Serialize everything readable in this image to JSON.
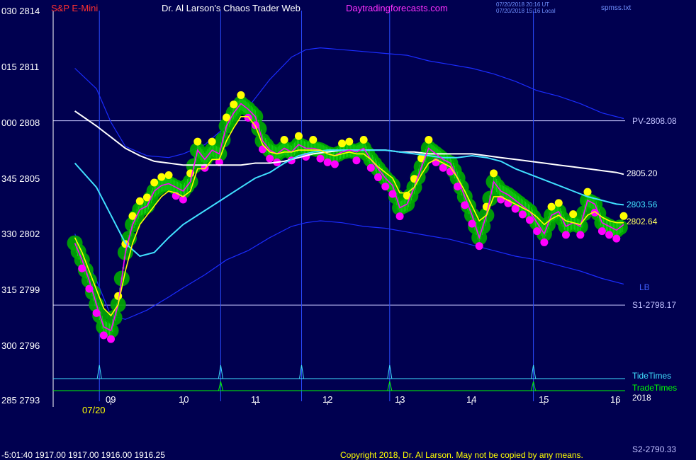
{
  "header": {
    "symbol": "S&P E-Mini",
    "title": "Dr. Al Larson's Chaos Trader Web",
    "site": "Daytradingforecasts.com",
    "stamp1": "07/20/2018 20:16 UT",
    "stamp2": "07/20/2018 15:16 Local",
    "file": "spmss.txt"
  },
  "y_axis": [
    {
      "label": "030  2814"
    },
    {
      "label": "015  2811"
    },
    {
      "label": "000  2808"
    },
    {
      "label": "345  2805"
    },
    {
      "label": "330  2802"
    },
    {
      "label": "315  2799"
    },
    {
      "label": "300  2796"
    },
    {
      "label": "285  2793"
    }
  ],
  "x_axis": {
    "hours": [
      "09",
      "10",
      "11",
      "12",
      "13",
      "14",
      "15",
      "16"
    ],
    "date": "07/20"
  },
  "right_labels": {
    "pv": "PV-2808.08",
    "white_ma": "2805.20",
    "cyan_ma": "2803.56",
    "yellow_ma": "2802.64",
    "lb": "LB",
    "s1": "S1-2798.17",
    "tide": "TideTimes",
    "trade": "TradeTimes",
    "year": "2018",
    "s2": "S2-2790.33"
  },
  "footer": {
    "quote": "-5:01:40  1917.00 1917.00 1916.00 1916.25",
    "copyright": "Copyright 2018, Dr. Al Larson. May not be copied by any means."
  },
  "colors": {
    "background": "#000050",
    "price": "#ff00ff",
    "bubble_green": "#00aa00",
    "yellow": "#ffff00",
    "cyan": "#40e0ff",
    "white": "#ffffff",
    "band": "#1a2cff",
    "tide": "#40e0ff",
    "trade": "#00ff00"
  },
  "chart_data": {
    "type": "line",
    "title": "S&P E-Mini",
    "ylim": [
      2793,
      2814
    ],
    "xlim": [
      8.5,
      16.1
    ],
    "pv_level": 2808.08,
    "s1_level": 2798.17,
    "tide_times": [
      8.84,
      10.52,
      11.64,
      12.86,
      14.85
    ],
    "trade_times": [
      10.52,
      12.86,
      14.85
    ],
    "series": [
      {
        "name": "price",
        "x": [
          8.5,
          8.6,
          8.7,
          8.8,
          8.9,
          9.0,
          9.1,
          9.2,
          9.3,
          9.4,
          9.5,
          9.6,
          9.7,
          9.8,
          9.9,
          10.0,
          10.1,
          10.2,
          10.3,
          10.4,
          10.5,
          10.6,
          10.7,
          10.8,
          10.9,
          11.0,
          11.1,
          11.2,
          11.3,
          11.4,
          11.5,
          11.6,
          11.7,
          11.8,
          11.9,
          12.0,
          12.1,
          12.2,
          12.3,
          12.4,
          12.5,
          12.6,
          12.7,
          12.8,
          12.9,
          13.0,
          13.1,
          13.2,
          13.3,
          13.4,
          13.5,
          13.6,
          13.7,
          13.8,
          13.9,
          14.0,
          14.1,
          14.2,
          14.3,
          14.4,
          14.5,
          14.6,
          14.7,
          14.8,
          14.9,
          15.0,
          15.1,
          15.2,
          15.3,
          15.4,
          15.5,
          15.6,
          15.7,
          15.8,
          15.9,
          16.0,
          16.1
        ],
        "values": [
          2801.5,
          2800.6,
          2799.5,
          2798.2,
          2797.0,
          2796.8,
          2798.2,
          2801.0,
          2802.5,
          2803.3,
          2803.5,
          2804.3,
          2804.6,
          2804.7,
          2804.5,
          2804.3,
          2804.8,
          2806.5,
          2806.0,
          2806.5,
          2806.3,
          2807.8,
          2808.5,
          2809.0,
          2808.7,
          2808.3,
          2807.0,
          2806.5,
          2806.3,
          2806.6,
          2806.4,
          2806.8,
          2806.6,
          2806.6,
          2806.5,
          2806.3,
          2806.2,
          2806.4,
          2806.5,
          2806.4,
          2806.6,
          2806.0,
          2805.5,
          2805.0,
          2804.6,
          2803.4,
          2803.6,
          2804.5,
          2805.6,
          2806.6,
          2806.3,
          2806.0,
          2805.8,
          2805.0,
          2804.0,
          2803.0,
          2801.8,
          2803.0,
          2804.8,
          2804.3,
          2804.1,
          2803.8,
          2803.5,
          2803.2,
          2802.6,
          2802.0,
          2803.0,
          2803.2,
          2802.4,
          2802.6,
          2802.4,
          2803.8,
          2803.6,
          2802.6,
          2802.4,
          2802.2,
          2802.5
        ]
      },
      {
        "name": "yellow",
        "x": [
          8.5,
          8.6,
          8.7,
          8.8,
          8.9,
          9.0,
          9.1,
          9.2,
          9.3,
          9.4,
          9.5,
          9.6,
          9.7,
          9.8,
          9.9,
          10.0,
          10.1,
          10.2,
          10.3,
          10.4,
          10.5,
          10.6,
          10.7,
          10.8,
          10.9,
          11.0,
          11.1,
          11.2,
          11.3,
          11.4,
          11.5,
          11.6,
          11.7,
          11.8,
          11.9,
          12.0,
          12.1,
          12.2,
          12.3,
          12.4,
          12.5,
          12.6,
          12.7,
          12.8,
          12.9,
          13.0,
          13.1,
          13.2,
          13.3,
          13.4,
          13.5,
          13.6,
          13.7,
          13.8,
          13.9,
          14.0,
          14.1,
          14.2,
          14.3,
          14.4,
          14.5,
          14.6,
          14.7,
          14.8,
          14.9,
          15.0,
          15.1,
          15.2,
          15.3,
          15.4,
          15.5,
          15.6,
          15.7,
          15.8,
          15.9,
          16.0,
          16.1
        ],
        "values": [
          2801.8,
          2801.0,
          2800.0,
          2799.0,
          2798.0,
          2797.6,
          2798.2,
          2800.0,
          2801.5,
          2802.5,
          2803.0,
          2803.5,
          2804.0,
          2804.3,
          2804.2,
          2804.0,
          2804.3,
          2805.5,
          2805.5,
          2806.0,
          2806.0,
          2807.0,
          2807.7,
          2808.3,
          2808.3,
          2807.8,
          2806.8,
          2806.4,
          2806.3,
          2806.4,
          2806.4,
          2806.5,
          2806.5,
          2806.5,
          2806.5,
          2806.3,
          2806.2,
          2806.3,
          2806.4,
          2806.3,
          2806.3,
          2806.0,
          2805.6,
          2805.3,
          2805.0,
          2804.2,
          2804.2,
          2804.5,
          2805.2,
          2805.8,
          2806.0,
          2805.8,
          2805.6,
          2805.0,
          2804.3,
          2803.5,
          2802.7,
          2803.0,
          2804.0,
          2804.0,
          2803.8,
          2803.6,
          2803.4,
          2803.2,
          2802.9,
          2802.5,
          2802.8,
          2803.0,
          2802.7,
          2802.6,
          2802.5,
          2803.0,
          2803.2,
          2802.9,
          2802.7,
          2802.6,
          2802.6
        ]
      },
      {
        "name": "cyan",
        "x": [
          8.5,
          8.8,
          9.0,
          9.2,
          9.4,
          9.6,
          9.8,
          10.0,
          10.2,
          10.4,
          10.6,
          10.8,
          11.0,
          11.2,
          11.4,
          11.6,
          11.8,
          12.0,
          12.2,
          12.4,
          12.6,
          12.8,
          13.0,
          13.2,
          13.4,
          13.6,
          13.8,
          14.0,
          14.2,
          14.4,
          14.6,
          14.8,
          15.0,
          15.2,
          15.4,
          15.6,
          15.8,
          16.0,
          16.1
        ],
        "values": [
          2805.8,
          2804.5,
          2803.0,
          2801.5,
          2800.8,
          2801.0,
          2801.8,
          2802.5,
          2803.0,
          2803.5,
          2804.0,
          2804.5,
          2805.0,
          2805.3,
          2805.8,
          2806.2,
          2806.4,
          2806.5,
          2806.5,
          2806.5,
          2806.5,
          2806.5,
          2806.4,
          2806.3,
          2806.2,
          2806.1,
          2806.1,
          2806.2,
          2806.1,
          2805.9,
          2805.5,
          2805.2,
          2804.9,
          2804.6,
          2804.3,
          2804.0,
          2803.8,
          2803.6,
          2803.56
        ]
      },
      {
        "name": "white",
        "x": [
          8.5,
          8.8,
          9.0,
          9.2,
          9.4,
          9.6,
          9.8,
          10.0,
          10.2,
          10.4,
          10.6,
          10.8,
          11.0,
          11.2,
          11.4,
          11.6,
          11.8,
          12.0,
          12.2,
          12.4,
          12.6,
          12.8,
          13.0,
          13.2,
          13.4,
          13.6,
          13.8,
          14.0,
          14.2,
          14.4,
          14.6,
          14.8,
          15.0,
          15.2,
          15.4,
          15.6,
          15.8,
          16.0,
          16.1
        ],
        "values": [
          2808.6,
          2807.8,
          2807.2,
          2806.6,
          2806.2,
          2805.9,
          2805.8,
          2805.7,
          2805.7,
          2805.7,
          2805.7,
          2805.7,
          2805.8,
          2805.8,
          2805.9,
          2806.1,
          2806.3,
          2806.4,
          2806.5,
          2806.5,
          2806.5,
          2806.5,
          2806.4,
          2806.4,
          2806.3,
          2806.3,
          2806.3,
          2806.3,
          2806.2,
          2806.1,
          2806.0,
          2805.9,
          2805.8,
          2805.7,
          2805.6,
          2805.5,
          2805.4,
          2805.3,
          2805.2
        ]
      },
      {
        "name": "band-upper",
        "x": [
          8.5,
          8.8,
          9.0,
          9.2,
          9.5,
          9.8,
          10.0,
          10.3,
          10.6,
          10.9,
          11.2,
          11.5,
          11.7,
          11.9,
          12.2,
          12.5,
          12.8,
          13.1,
          13.4,
          13.7,
          14.0,
          14.3,
          14.6,
          14.9,
          15.2,
          15.5,
          15.8,
          16.1
        ],
        "values": [
          2810.9,
          2809.8,
          2808.0,
          2806.7,
          2806.2,
          2806.1,
          2806.3,
          2806.8,
          2807.8,
          2808.8,
          2810.3,
          2811.5,
          2811.9,
          2812.0,
          2811.9,
          2811.8,
          2811.7,
          2811.6,
          2811.3,
          2811.1,
          2810.9,
          2810.6,
          2810.2,
          2809.7,
          2809.4,
          2809.0,
          2808.5,
          2808.2
        ]
      },
      {
        "name": "band-lower",
        "x": [
          8.5,
          8.8,
          9.0,
          9.2,
          9.5,
          9.8,
          10.0,
          10.3,
          10.6,
          10.9,
          11.2,
          11.5,
          11.7,
          11.9,
          12.2,
          12.5,
          12.8,
          13.1,
          13.4,
          13.7,
          14.0,
          14.3,
          14.6,
          14.9,
          15.2,
          15.5,
          15.8,
          16.1
        ],
        "values": [
          2802.0,
          2799.5,
          2797.6,
          2797.4,
          2797.9,
          2798.6,
          2799.1,
          2799.8,
          2800.6,
          2801.1,
          2801.8,
          2802.4,
          2802.6,
          2802.7,
          2802.6,
          2802.4,
          2802.3,
          2802.1,
          2801.9,
          2801.7,
          2801.4,
          2801.1,
          2800.8,
          2800.6,
          2800.3,
          2800.0,
          2799.6,
          2799.3
        ]
      }
    ]
  }
}
